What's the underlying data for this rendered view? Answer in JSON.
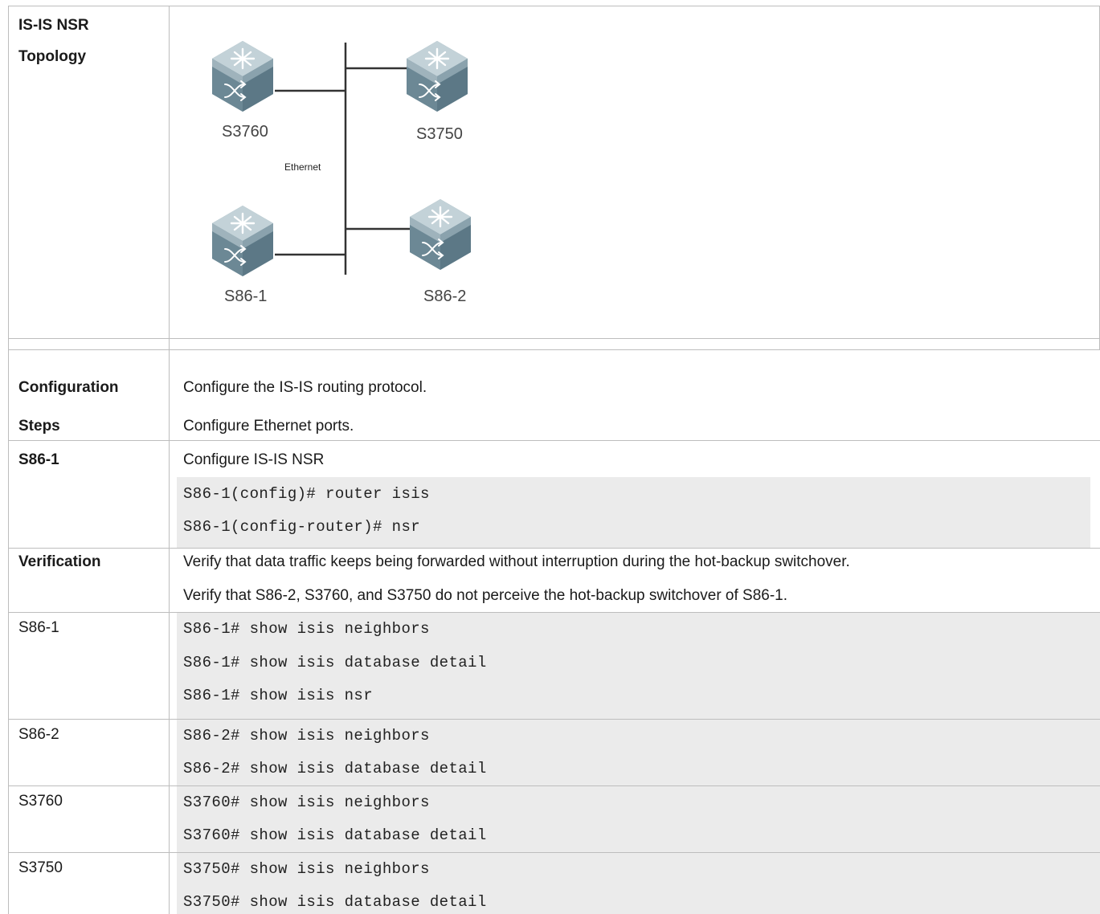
{
  "topology": {
    "label_line1": "IS-IS NSR",
    "label_line2": "Topology",
    "devices": {
      "s3760": "S3760",
      "s3750": "S3750",
      "s86_1": "S86-1",
      "s86_2": "S86-2"
    },
    "ethernet_label": "Ethernet",
    "device_icon": "switch-icon"
  },
  "config_steps": {
    "label_line1": "Configuration",
    "label_line2": "Steps",
    "steps": [
      "Configure the IS-IS routing protocol.",
      "Configure Ethernet ports."
    ]
  },
  "s86_1_config": {
    "label": "S86-1",
    "description": "Configure IS-IS NSR",
    "commands": [
      "S86-1(config)# router isis",
      "S86-1(config-router)# nsr"
    ]
  },
  "verification": {
    "label": "Verification",
    "lines": [
      "Verify that data traffic keeps being forwarded without interruption during the hot-backup switchover.",
      "Verify that S86-2, S3760, and S3750 do not perceive the hot-backup switchover of S86-1."
    ]
  },
  "verify_rows": [
    {
      "label": "S86-1",
      "commands": [
        "S86-1# show isis neighbors",
        "S86-1# show isis database detail",
        "S86-1# show isis nsr"
      ]
    },
    {
      "label": "S86-2",
      "commands": [
        "S86-2# show isis neighbors",
        "S86-2# show isis database detail"
      ]
    },
    {
      "label": "S3760",
      "commands": [
        "S3760# show isis neighbors",
        "S3760# show isis database detail"
      ]
    },
    {
      "label": "S3750",
      "commands": [
        "S3750# show isis neighbors",
        "S3750# show isis database detail"
      ]
    }
  ],
  "colors": {
    "border": "#bdbdbd",
    "code_background": "#ebebeb",
    "device_body": "#7e9aa6",
    "device_top": "#c3d2d8"
  }
}
